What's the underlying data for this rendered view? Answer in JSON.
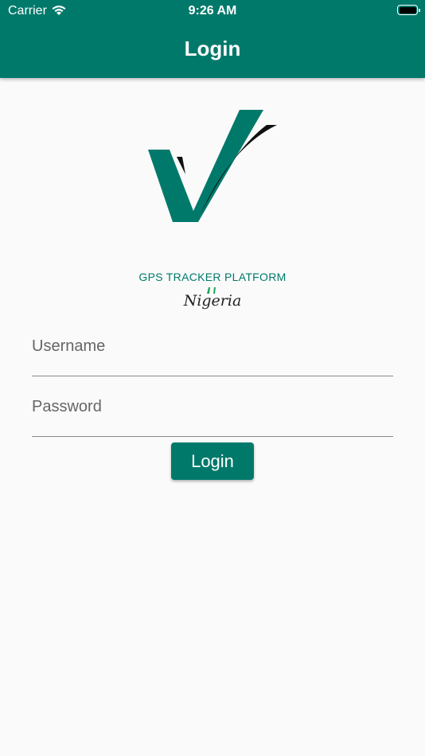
{
  "status_bar": {
    "carrier": "Carrier",
    "time": "9:26 AM"
  },
  "header": {
    "title": "Login"
  },
  "brand": {
    "tagline": "GPS TRACKER PLATFORM",
    "country": "Nigeria"
  },
  "form": {
    "username": {
      "label": "Username",
      "value": ""
    },
    "password": {
      "label": "Password",
      "value": ""
    },
    "submit_label": "Login"
  },
  "colors": {
    "primary": "#00796b",
    "background": "#fafafa"
  },
  "icons": {
    "wifi": "wifi-icon",
    "battery": "battery-icon",
    "logo": "checkmark-logo"
  }
}
